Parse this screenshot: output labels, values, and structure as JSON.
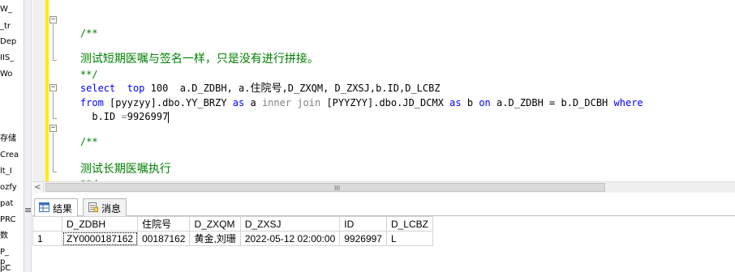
{
  "explorer": {
    "lines": [
      "W_",
      "_tr",
      "Dep",
      "IIS_",
      "Wo",
      "存储",
      "Crea",
      "lt_I",
      "ozfy",
      "pat",
      "PRC",
      "数",
      "P_",
      "p_",
      "pC"
    ]
  },
  "editor": {
    "comment_open": "/**",
    "comment1_text": "测试短期医嘱与签名一样，只是没有进行拼接。",
    "comment_close": "**/",
    "select_kw": "select",
    "top_kw": "top",
    "top_n": "100",
    "select_cols_a": "a.D_ZDBH,",
    "select_cols_b": "a.",
    "select_cols_cjk": "住院号",
    "select_cols_c": ",D_ZXQM, D_ZXSJ,b.ID,D_LCBZ",
    "from_kw": "from",
    "table1": "[pyyzyy].dbo.YY_BRZY",
    "as_kw1": "as",
    "alias_a": "a",
    "inner_kw": "inner",
    "join_kw": "join",
    "table2": "[PYYZYY].dbo.JD_DCMX",
    "as_kw2": "as",
    "alias_b": "b",
    "on_kw": "on",
    "join_cond": "a.D_ZDBH = b.D_DCBH",
    "where_kw": "where",
    "where_cond_left": "b.ID",
    "where_eq": "=",
    "where_value": "9926997",
    "comment2_open": "/**",
    "comment2_text": "测试长期医嘱执行",
    "comment2_close": "**/"
  },
  "scrollbar": {
    "left_arrow": "<",
    "grip": "III"
  },
  "results": {
    "tabs": [
      {
        "label": "结果",
        "icon": "grid-icon",
        "active": true
      },
      {
        "label": "消息",
        "icon": "message-icon",
        "active": false
      }
    ],
    "columns": [
      "D_ZDBH",
      "住院号",
      "D_ZXQM",
      "D_ZXSJ",
      "ID",
      "D_LCBZ"
    ],
    "rows": [
      {
        "rownum": "1",
        "cells": [
          "ZY0000187162",
          "00187162",
          "黄金,刘珊",
          "2022-05-12 02:00:00",
          "9926997",
          "L"
        ]
      }
    ]
  },
  "splitter_glyph": "≡"
}
